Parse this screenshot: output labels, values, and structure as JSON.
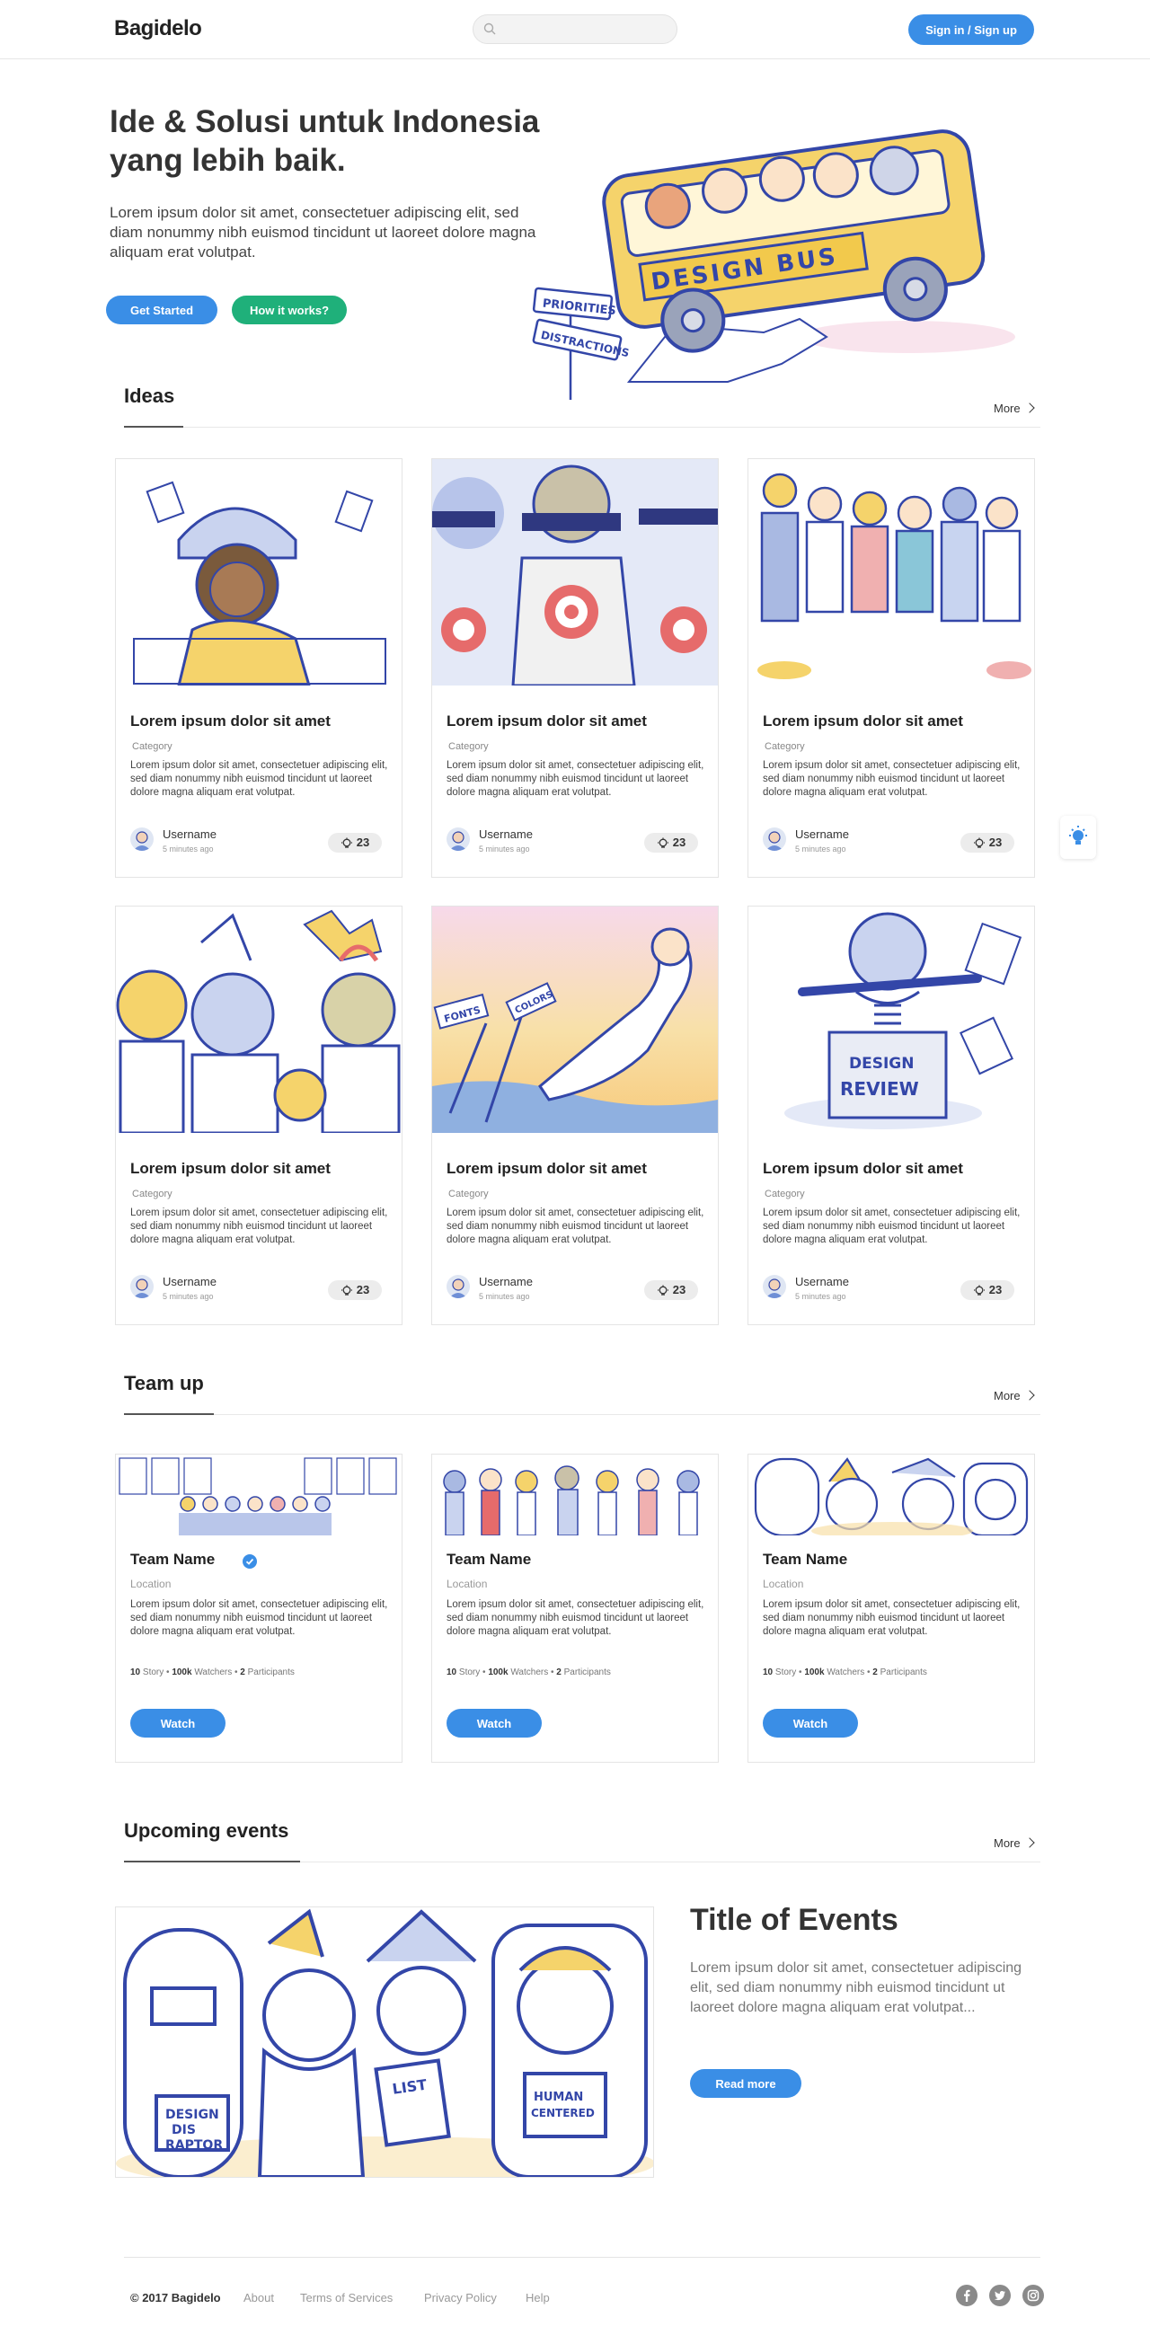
{
  "nav": {
    "logo": "Bagidelo",
    "search_placeholder": "",
    "signin_label": "Sign in / Sign up"
  },
  "hero": {
    "title": "Ide & Solusi untuk Indonesia yang lebih baik.",
    "text": "Lorem ipsum dolor sit amet, consectetuer adipiscing elit, sed diam nonummy nibh euismod tincidunt ut laoreet dolore magna aliquam erat volutpat.",
    "get_started": "Get Started",
    "how_it_works": "How it works?"
  },
  "ideas": {
    "title": "Ideas",
    "more": "More",
    "cards": [
      {
        "title": "Lorem ipsum dolor sit amet",
        "category": "Category",
        "desc": "Lorem ipsum dolor sit amet, consectetuer adipiscing elit, sed diam nonummy nibh euismod tincidunt ut laoreet dolore magna aliquam erat volutpat.",
        "user": "Username",
        "time": "5 minutes ago",
        "likes": "23"
      },
      {
        "title": "Lorem ipsum dolor sit amet",
        "category": "Category",
        "desc": "Lorem ipsum dolor sit amet, consectetuer adipiscing elit, sed diam nonummy nibh euismod tincidunt ut laoreet dolore magna aliquam erat volutpat.",
        "user": "Username",
        "time": "5 minutes ago",
        "likes": "23"
      },
      {
        "title": "Lorem ipsum dolor sit amet",
        "category": "Category",
        "desc": "Lorem ipsum dolor sit amet, consectetuer adipiscing elit, sed diam nonummy nibh euismod tincidunt ut laoreet dolore magna aliquam erat volutpat.",
        "user": "Username",
        "time": "5 minutes ago",
        "likes": "23"
      },
      {
        "title": "Lorem ipsum dolor sit amet",
        "category": "Category",
        "desc": "Lorem ipsum dolor sit amet, consectetuer adipiscing elit, sed diam nonummy nibh euismod tincidunt ut laoreet dolore magna aliquam erat volutpat.",
        "user": "Username",
        "time": "5 minutes ago",
        "likes": "23"
      },
      {
        "title": "Lorem ipsum dolor sit amet",
        "category": "Category",
        "desc": "Lorem ipsum dolor sit amet, consectetuer adipiscing elit, sed diam nonummy nibh euismod tincidunt ut laoreet dolore magna aliquam erat volutpat.",
        "user": "Username",
        "time": "5 minutes ago",
        "likes": "23"
      },
      {
        "title": "Lorem ipsum dolor sit amet",
        "category": "Category",
        "desc": "Lorem ipsum dolor sit amet, consectetuer adipiscing elit, sed diam nonummy nibh euismod tincidunt ut laoreet dolore magna aliquam erat volutpat.",
        "user": "Username",
        "time": "5 minutes ago",
        "likes": "23"
      }
    ]
  },
  "team": {
    "title": "Team up",
    "more": "More",
    "cards": [
      {
        "name": "Team Name",
        "location": "Location",
        "desc": "Lorem ipsum dolor sit amet, consectetuer adipiscing elit, sed diam nonummy nibh euismod tincidunt ut laoreet dolore magna aliquam erat volutpat.",
        "story_count": "10",
        "story_label": "Story",
        "watchers_count": "100k",
        "watchers_label": "Watchers",
        "participants_count": "2",
        "participants_label": "Participants",
        "watch": "Watch"
      },
      {
        "name": "Team Name",
        "location": "Location",
        "desc": "Lorem ipsum dolor sit amet, consectetuer adipiscing elit, sed diam nonummy nibh euismod tincidunt ut laoreet dolore magna aliquam erat volutpat.",
        "story_count": "10",
        "story_label": "Story",
        "watchers_count": "100k",
        "watchers_label": "Watchers",
        "participants_count": "2",
        "participants_label": "Participants",
        "watch": "Watch"
      },
      {
        "name": "Team Name",
        "location": "Location",
        "desc": "Lorem ipsum dolor sit amet, consectetuer adipiscing elit, sed diam nonummy nibh euismod tincidunt ut laoreet dolore magna aliquam erat volutpat.",
        "story_count": "10",
        "story_label": "Story",
        "watchers_count": "100k",
        "watchers_label": "Watchers",
        "participants_count": "2",
        "participants_label": "Participants",
        "watch": "Watch"
      }
    ]
  },
  "events": {
    "title": "Upcoming events",
    "more": "More",
    "event_title": "Title of Events",
    "event_desc": "Lorem ipsum dolor sit amet, consectetuer adipiscing elit, sed diam nonummy nibh euismod tincidunt ut laoreet dolore magna aliquam erat volutpat...",
    "read_more": "Read more"
  },
  "footer": {
    "copyright": "© 2017 Bagidelo",
    "links": [
      "About",
      "Terms of Services",
      "Privacy Policy",
      "Help"
    ],
    "social": [
      "facebook-icon",
      "twitter-icon",
      "instagram-icon"
    ]
  },
  "colors": {
    "primary": "#3a8ee6",
    "green": "#1fb07a",
    "illustration_ink": "#3346a8",
    "illustration_yellow": "#f5d36b"
  }
}
